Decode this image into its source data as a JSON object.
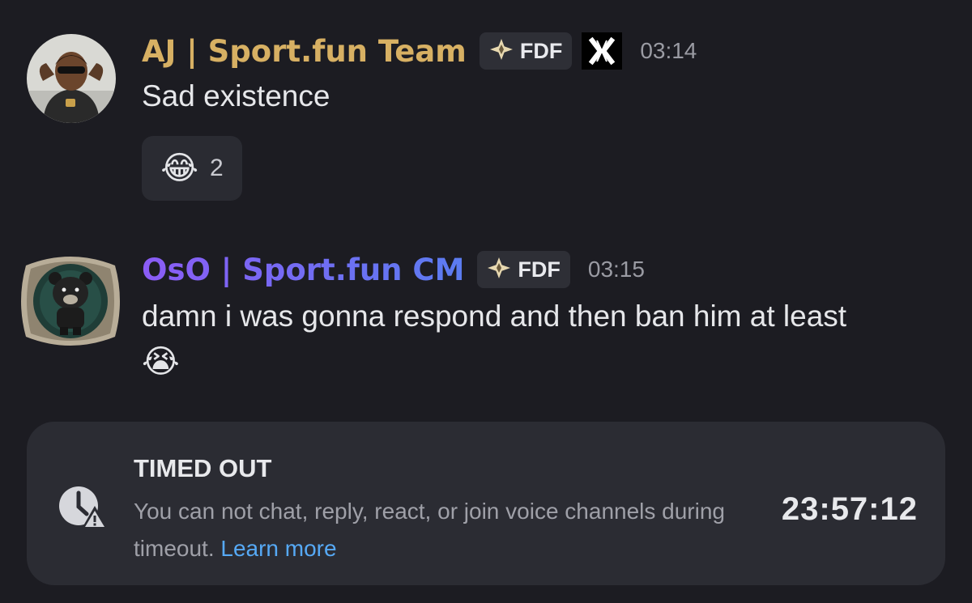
{
  "messages": [
    {
      "username": "AJ | Sport.fun Team",
      "username_color": "#d7b063",
      "tag": "FDF",
      "timestamp": "03:14",
      "text": "Sad existence",
      "reaction": {
        "emoji": "😂",
        "count": "2"
      }
    },
    {
      "username": "OsO | Sport.fun CM",
      "username_gradient": [
        "#8b5cf6",
        "#5b7cf0"
      ],
      "tag": "FDF",
      "timestamp": "03:15",
      "text_line1": "damn i was gonna respond and then ban him at least",
      "text_emoji": "😭"
    }
  ],
  "timeout": {
    "title": "TIMED OUT",
    "description": "You can not chat, reply, react, or join voice channels during timeout.",
    "link": "Learn more",
    "timer": "23:57:12"
  },
  "icons": {
    "tag_icon": "sparkle-diamond-icon",
    "x_badge": "x-logo-icon",
    "timeout_icon": "clock-warning-icon"
  }
}
